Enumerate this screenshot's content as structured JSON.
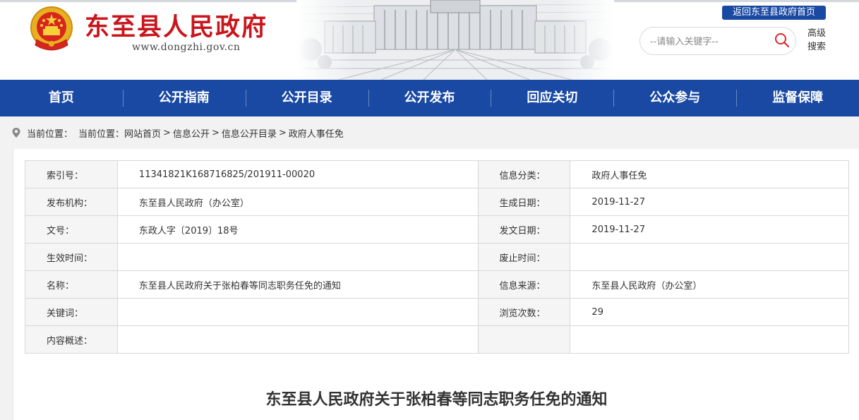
{
  "header": {
    "site_title": "东至县人民政府",
    "site_url": "www.dongzhi.gov.cn",
    "return_link": "返回东至县政府首页",
    "search_placeholder": "--请输入关键字--",
    "advanced_search": "高级搜索",
    "brand_blue": "#1a49a3",
    "title_red": "#c8161d"
  },
  "nav": {
    "items": [
      {
        "label": "首页"
      },
      {
        "label": "公开指南"
      },
      {
        "label": "公开目录"
      },
      {
        "label": "公开发布"
      },
      {
        "label": "回应关切"
      },
      {
        "label": "公众参与"
      },
      {
        "label": "监督保障"
      }
    ]
  },
  "breadcrumb": {
    "prefix": "当前位置：",
    "items": [
      "当前位置：网站首页",
      "信息公开",
      "信息公开目录",
      "政府人事任免"
    ],
    "separator": ">"
  },
  "info": {
    "rows": [
      {
        "label1": "索引号：",
        "value1": "11341821K168716825/201911-00020",
        "label2": "信息分类：",
        "value2": "政府人事任免"
      },
      {
        "label1": "发布机构：",
        "value1": "东至县人民政府（办公室）",
        "label2": "生成日期：",
        "value2": "2019-11-27"
      },
      {
        "label1": "文号：",
        "value1": "东政人字〔2019〕18号",
        "label2": "发文日期：",
        "value2": "2019-11-27"
      },
      {
        "label1": "生效时间：",
        "value1": "",
        "label2": "废止时间：",
        "value2": ""
      },
      {
        "label1": "名称：",
        "value1": "东至县人民政府关于张柏春等同志职务任免的通知",
        "label2": "信息来源：",
        "value2": "东至县人民政府（办公室）"
      },
      {
        "label1": "关键词：",
        "value1": "",
        "label2": "浏览次数：",
        "value2": "29"
      },
      {
        "label1": "内容概述：",
        "value1": "",
        "label2": "",
        "value2": ""
      }
    ]
  },
  "document": {
    "title": "东至县人民政府关于张柏春等同志职务任免的通知"
  }
}
